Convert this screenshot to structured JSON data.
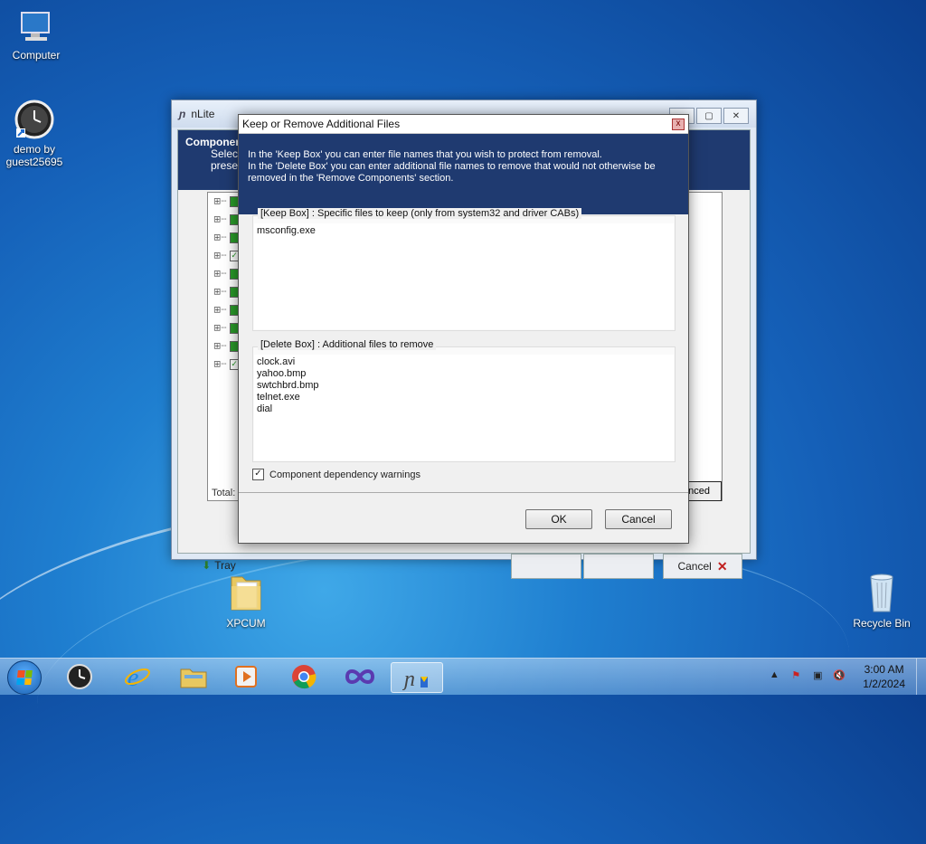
{
  "desktop": {
    "icons": [
      {
        "label": "Computer"
      },
      {
        "label": "demo by\nguest25695"
      },
      {
        "label": "XPCUM"
      },
      {
        "label": "Recycle Bin"
      }
    ]
  },
  "main_window": {
    "title": "nLite",
    "header_title": "Componen",
    "header_sub1": "Select",
    "header_sub2": "preser",
    "total_label": "Total: S",
    "advanced_label": "nced",
    "tray_label": "Tray",
    "cancel_label": "Cancel"
  },
  "dialog": {
    "title": "Keep or Remove Additional Files",
    "close_label": "x",
    "description_line1": "In the 'Keep Box' you can enter file names that you wish to protect from removal.",
    "description_line2": "In the 'Delete Box' you can enter additional file names to remove that would not otherwise be",
    "description_line3": "removed in the 'Remove Components' section.",
    "keep_box": {
      "label": "[Keep Box] : Specific files to keep (only from system32 and driver CABs)",
      "value": "msconfig.exe"
    },
    "delete_box": {
      "label": "[Delete Box] : Additional files to remove",
      "value": "clock.avi\nyahoo.bmp\nswtchbrd.bmp\ntelnet.exe\ndial"
    },
    "dependency_warnings": {
      "label": "Component dependency warnings",
      "checked": true
    },
    "ok_label": "OK",
    "cancel_label": "Cancel"
  },
  "taskbar": {
    "apps": [
      "clock-app",
      "internet-explorer",
      "file-explorer",
      "media-player",
      "chrome",
      "infinity-app",
      "nlite"
    ],
    "clock_time": "3:00 AM",
    "clock_date": "1/2/2024"
  }
}
